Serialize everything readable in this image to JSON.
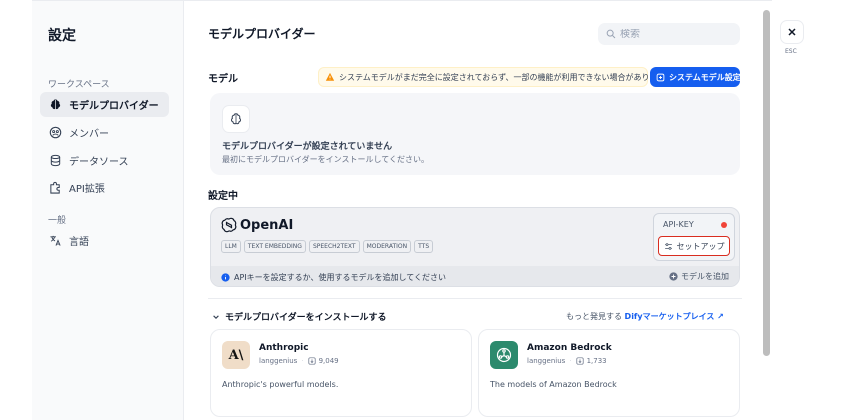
{
  "sidebar": {
    "title": "設定",
    "group_workspace": "ワークスペース",
    "group_general": "一般",
    "items": [
      {
        "label": "モデルプロバイダー",
        "icon": "brain-icon",
        "active": true
      },
      {
        "label": "メンバー",
        "icon": "members-icon"
      },
      {
        "label": "データソース",
        "icon": "database-icon"
      },
      {
        "label": "API拡張",
        "icon": "puzzle-icon"
      },
      {
        "label": "言語",
        "icon": "translate-icon"
      }
    ]
  },
  "header": {
    "title": "モデルプロバイダー",
    "search_placeholder": "検索"
  },
  "model_section": {
    "label": "モデル",
    "warning": "システムモデルがまだ完全に設定されておらず、一部の機能が利用できない場合があります。",
    "system_button": "システムモデル設定",
    "empty_title": "モデルプロバイダーが設定されていません",
    "empty_desc": "最初にモデルプロバイダーをインストールしてください。"
  },
  "configured": {
    "label": "設定中",
    "provider": {
      "name": "OpenAI",
      "tags": [
        "LLM",
        "TEXT EMBEDDING",
        "SPEECH2TEXT",
        "MODERATION",
        "TTS"
      ],
      "api_key_label": "API-KEY",
      "setup_button": "セットアップ",
      "footer_text": "APIキーを設定するか、使用するモデルを追加してください",
      "add_model": "モデルを追加"
    }
  },
  "install": {
    "header": "モデルプロバイダーをインストールする",
    "discover_prefix": "もっと発見する",
    "discover_link": "Difyマーケットプレイス",
    "providers": [
      {
        "name": "Anthropic",
        "org": "langgenius",
        "installs": "9,049",
        "desc": "Anthropic's powerful models.",
        "logo_bg": "#f0ddc8",
        "logo_text": "A\\"
      },
      {
        "name": "Amazon Bedrock",
        "org": "langgenius",
        "installs": "1,733",
        "desc": "The models of Amazon Bedrock",
        "logo_bg": "#2c8a6d",
        "logo_text": ""
      }
    ]
  },
  "close": {
    "esc_label": "ESC"
  },
  "colors": {
    "accent": "#155eef",
    "danger": "#d92d20",
    "warning": "#f79009"
  }
}
